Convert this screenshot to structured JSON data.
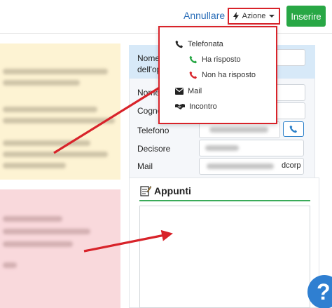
{
  "toolbar": {
    "cancel_label": "Annullare",
    "action_label": "Azione",
    "insert_label": "Inserire"
  },
  "action_menu": {
    "items": [
      {
        "label": "Telefonata",
        "icon": "phone-icon"
      },
      {
        "label": "Ha risposto",
        "icon": "phone-green-icon"
      },
      {
        "label": "Non ha risposto",
        "icon": "phone-red-icon"
      },
      {
        "label": "Mail",
        "icon": "envelope-icon"
      },
      {
        "label": "Incontro",
        "icon": "handshake-icon"
      }
    ]
  },
  "form": {
    "labels": {
      "nome_opp_line1": "Nome",
      "nome_opp_line2": "dell'opp",
      "nome": "Nome",
      "cognome": "Cognom",
      "telefono": "Telefono",
      "decisore": "Decisore",
      "mail": "Mail"
    },
    "mail_fragment": "dcorp"
  },
  "notes": {
    "title": "Appunti"
  },
  "help": {
    "label": "?"
  },
  "colors": {
    "accent_red": "#d8232a",
    "success_green": "#28a745",
    "link_blue": "#2a6db8",
    "highlight_blue": "#d7e9f8",
    "panel_yellow": "#fdf3d3",
    "panel_pink": "#f9d9dc"
  }
}
